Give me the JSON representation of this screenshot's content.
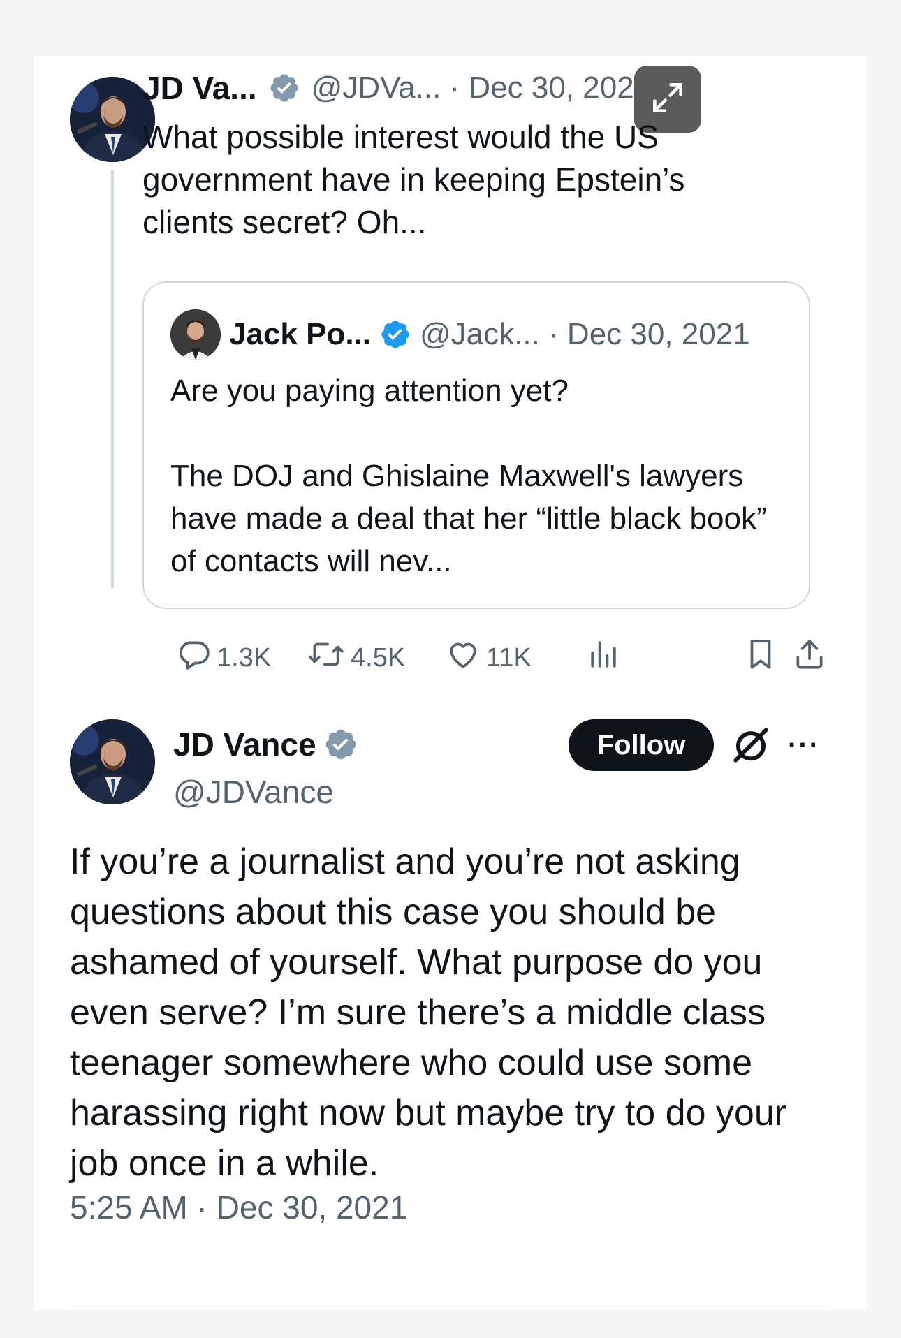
{
  "parent_tweet": {
    "author_name": "JD Va...",
    "handle_date": "@JDVa... · Dec 30, 2021",
    "text": "What possible interest would the US government have in keeping Epstein’s clients secret? Oh...",
    "quoted": {
      "author_name": "Jack Po...",
      "handle_date": "@Jack... · Dec 30, 2021",
      "line1": "Are you paying attention yet?",
      "line2": "The DOJ and Ghislaine Maxwell's lawyers have made a deal that her “little black book” of contacts will nev..."
    },
    "actions": {
      "replies": "1.3K",
      "reposts": "4.5K",
      "likes": "11K"
    }
  },
  "main_tweet": {
    "author_name": "JD Vance",
    "handle": "@JDVance",
    "follow_label": "Follow",
    "more_label": "···",
    "text": "If you’re a journalist and you’re not asking questions about this case you should be ashamed of yourself. What purpose do you even serve? I’m sure there’s a middle class teenager somewhere who could use some harassing right now but maybe try to do your job once in a while.",
    "timestamp": "5:25 AM · Dec 30, 2021"
  },
  "colors": {
    "verified_gray": "#829aab",
    "verified_blue": "#1d9bf0",
    "text": "#0f1419",
    "muted": "#536471"
  },
  "icons": [
    "avatar",
    "verified-badge-icon",
    "grok-icon",
    "expand-icon",
    "reply-icon",
    "repost-icon",
    "like-icon",
    "views-icon",
    "bookmark-icon",
    "share-icon",
    "more-icon"
  ]
}
